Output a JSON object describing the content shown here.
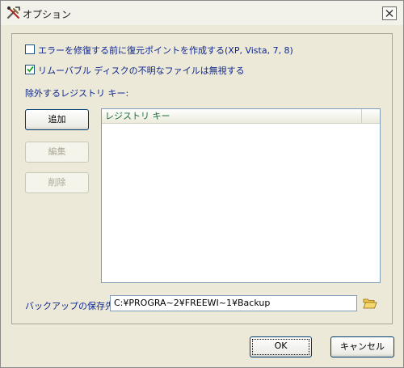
{
  "window": {
    "title": "オプション",
    "title_icon": "tools-icon",
    "close_icon": "close-icon"
  },
  "options": [
    {
      "label": "エラーを修復する前に復元ポイントを作成する(XP, Vista, 7, 8)",
      "checked": false
    },
    {
      "label": "リムーバブル ディスクの不明なファイルは無視する",
      "checked": true
    }
  ],
  "exclude": {
    "label": "除外するレジストリ キー:",
    "add_label": "追加",
    "edit_label": "編集",
    "delete_label": "削除",
    "column_header": "レジストリ キー"
  },
  "backup": {
    "label": "バックアップの保存先:",
    "path": "C:¥PROGRA~2¥FREEWI~1¥Backup",
    "browse_icon": "folder-open-icon"
  },
  "footer": {
    "ok_label": "OK",
    "cancel_label": "キャンセル"
  },
  "colors": {
    "label_text": "#10288f",
    "column_header_text": "#1d6f3b",
    "disabled_text": "#aca899"
  }
}
